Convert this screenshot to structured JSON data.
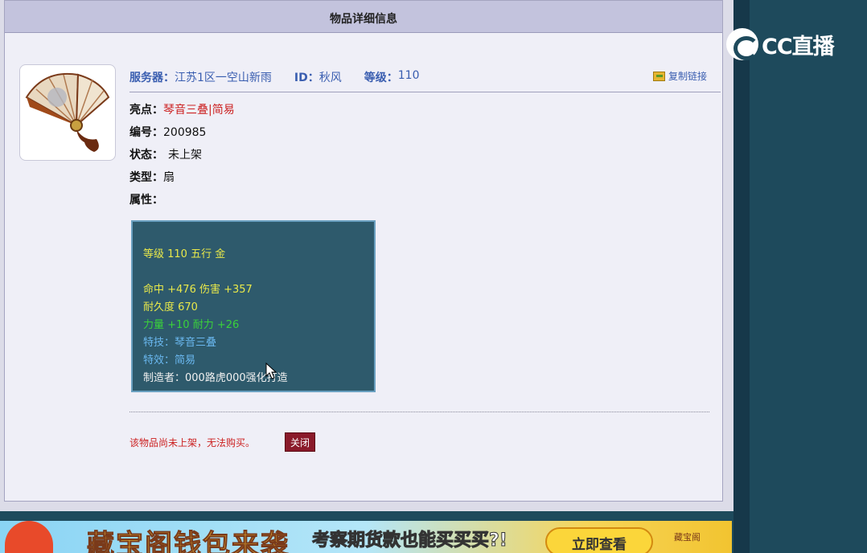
{
  "panel": {
    "title": "物品详细信息"
  },
  "info": {
    "server_label": "服务器：",
    "server_value": "江苏1区一空山新雨",
    "id_label": "ID：",
    "id_value": "秋风",
    "level_label": "等级：",
    "level_value": "110",
    "copy_link": "复制链接"
  },
  "fields": {
    "highlight_label": "亮点：",
    "highlight_value": "琴音三叠|简易",
    "number_label": "编号：",
    "number_value": "200985",
    "status_label": "状态：",
    "status_value": "未上架",
    "type_label": "类型：",
    "type_value": "扇",
    "attributes_label": "属性："
  },
  "attributes": {
    "line1": "等级 110 五行 金",
    "line2": "命中 +476 伤害 +357",
    "line3": "耐久度 670",
    "line4": "力量 +10 耐力 +26",
    "line5": "特技：琴音三叠",
    "line6": "特效：简易",
    "line7": "制造者：000路虎000强化打造"
  },
  "footer": {
    "notice": "该物品尚未上架，无法购买。",
    "close_button": "关闭"
  },
  "overlay": {
    "logo_text": "CC直播"
  },
  "banner": {
    "title": "藏宝阁钱包来袭",
    "subtitle": "考察期货款也能买买买?!",
    "button": "立即查看",
    "logo": "藏宝阁"
  },
  "colors": {
    "panel_bg": "#efeff7",
    "title_bar": "#c3c3dd",
    "link_blue": "#3a5eb0",
    "highlight_red": "#cc2222",
    "attr_bg": "#2e5a6c",
    "attr_yellow": "#e8e84a",
    "attr_green": "#3ad23a",
    "attr_blue": "#6ab8f0",
    "close_btn": "#8a1a2a"
  },
  "icons": {
    "item": "folding-fan-icon",
    "copy": "folder-link-icon",
    "cursor": "mouse-pointer-icon",
    "logo": "cc-live-logo-icon"
  }
}
